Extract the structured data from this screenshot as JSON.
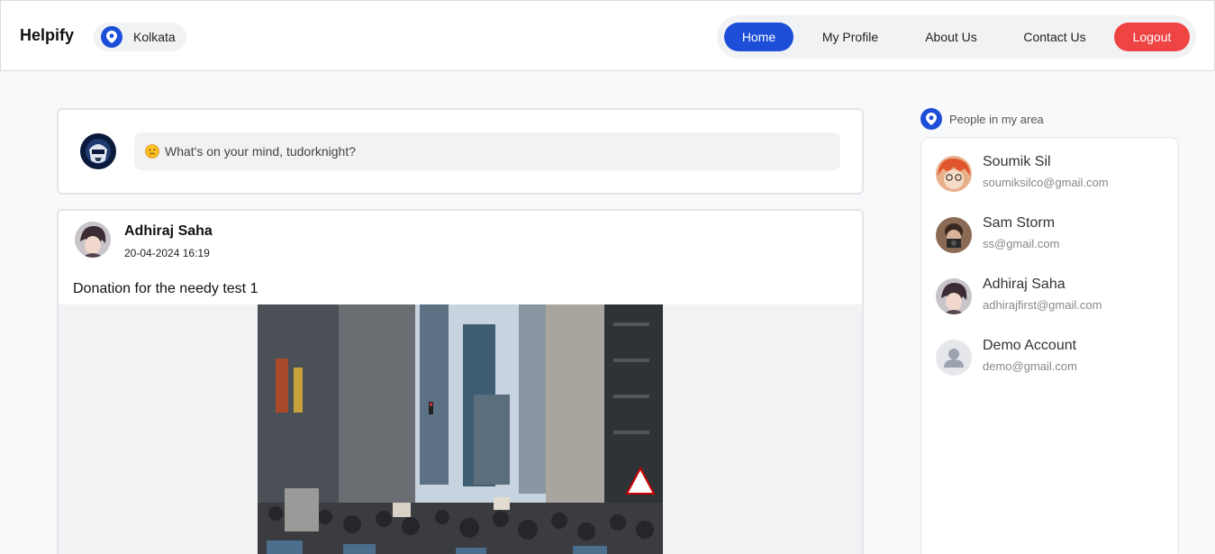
{
  "header": {
    "brand": "Helpify",
    "location": "Kolkata",
    "nav": {
      "home": "Home",
      "profile": "My Profile",
      "about": "About Us",
      "contact": "Contact Us",
      "logout": "Logout"
    }
  },
  "composer": {
    "placeholder": "What's on your mind, tudorknight?",
    "emoji_icon": "thinking-face-emoji"
  },
  "post": {
    "author": "Adhiraj Saha",
    "timestamp": "20-04-2024 16:19",
    "text": "Donation for the needy test 1"
  },
  "sidebar": {
    "title": "People in my area",
    "people": [
      {
        "name": "Soumik Sil",
        "email": "soumiksilco@gmail.com"
      },
      {
        "name": "Sam Storm",
        "email": "ss@gmail.com"
      },
      {
        "name": "Adhiraj Saha",
        "email": "adhirajfirst@gmail.com"
      },
      {
        "name": "Demo Account",
        "email": "demo@gmail.com"
      }
    ]
  },
  "colors": {
    "primary": "#1d4ed8",
    "danger": "#ef4444"
  }
}
